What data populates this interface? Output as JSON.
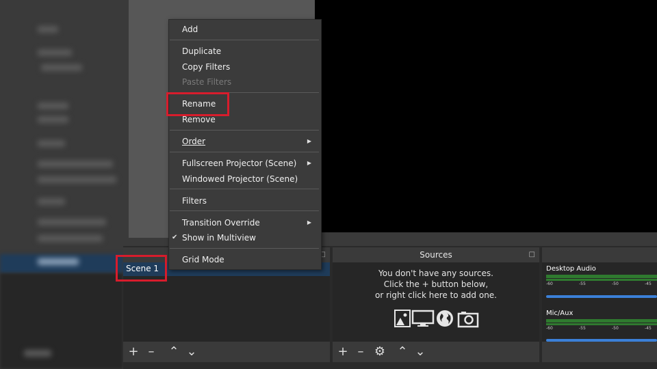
{
  "context_menu": {
    "items": [
      {
        "label": "Add"
      },
      {
        "label": "Duplicate"
      },
      {
        "label": "Copy Filters"
      },
      {
        "label": "Paste Filters",
        "disabled": true
      },
      {
        "label": "Rename",
        "highlighted": true
      },
      {
        "label": "Remove"
      },
      {
        "label": "Order",
        "submenu": true
      },
      {
        "label": "Fullscreen Projector (Scene)",
        "submenu": true
      },
      {
        "label": "Windowed Projector (Scene)"
      },
      {
        "label": "Filters"
      },
      {
        "label": "Transition Override",
        "submenu": true
      },
      {
        "label": "Show in Multiview",
        "checked": true
      },
      {
        "label": "Grid Mode"
      }
    ]
  },
  "scenes": {
    "items": [
      "Scene 1"
    ],
    "selected": "Scene 1"
  },
  "sources": {
    "title": "Sources",
    "empty_line1": "You don't have any sources.",
    "empty_line2": "Click the + button below,",
    "empty_line3": "or right click here to add one.",
    "icons": [
      "image-icon",
      "display-capture-icon",
      "globe-icon",
      "camera-icon"
    ]
  },
  "mixer": {
    "channels": [
      {
        "name": "Desktop Audio",
        "scale": [
          "-60",
          "-55",
          "-50",
          "-45"
        ]
      },
      {
        "name": "Mic/Aux",
        "scale": [
          "-60",
          "-55",
          "-50",
          "-45"
        ]
      }
    ]
  },
  "toolbar_icons": {
    "scenes": [
      "add-icon",
      "remove-icon",
      "move-up-icon",
      "move-down-icon"
    ],
    "sources": [
      "add-icon",
      "remove-icon",
      "settings-icon",
      "move-up-icon",
      "move-down-icon"
    ]
  },
  "colors": {
    "highlight_border": "#d81c2c",
    "selection": "#1f3c5a",
    "meter_green": "#2f7a2f",
    "slider_blue": "#3b80d8"
  }
}
